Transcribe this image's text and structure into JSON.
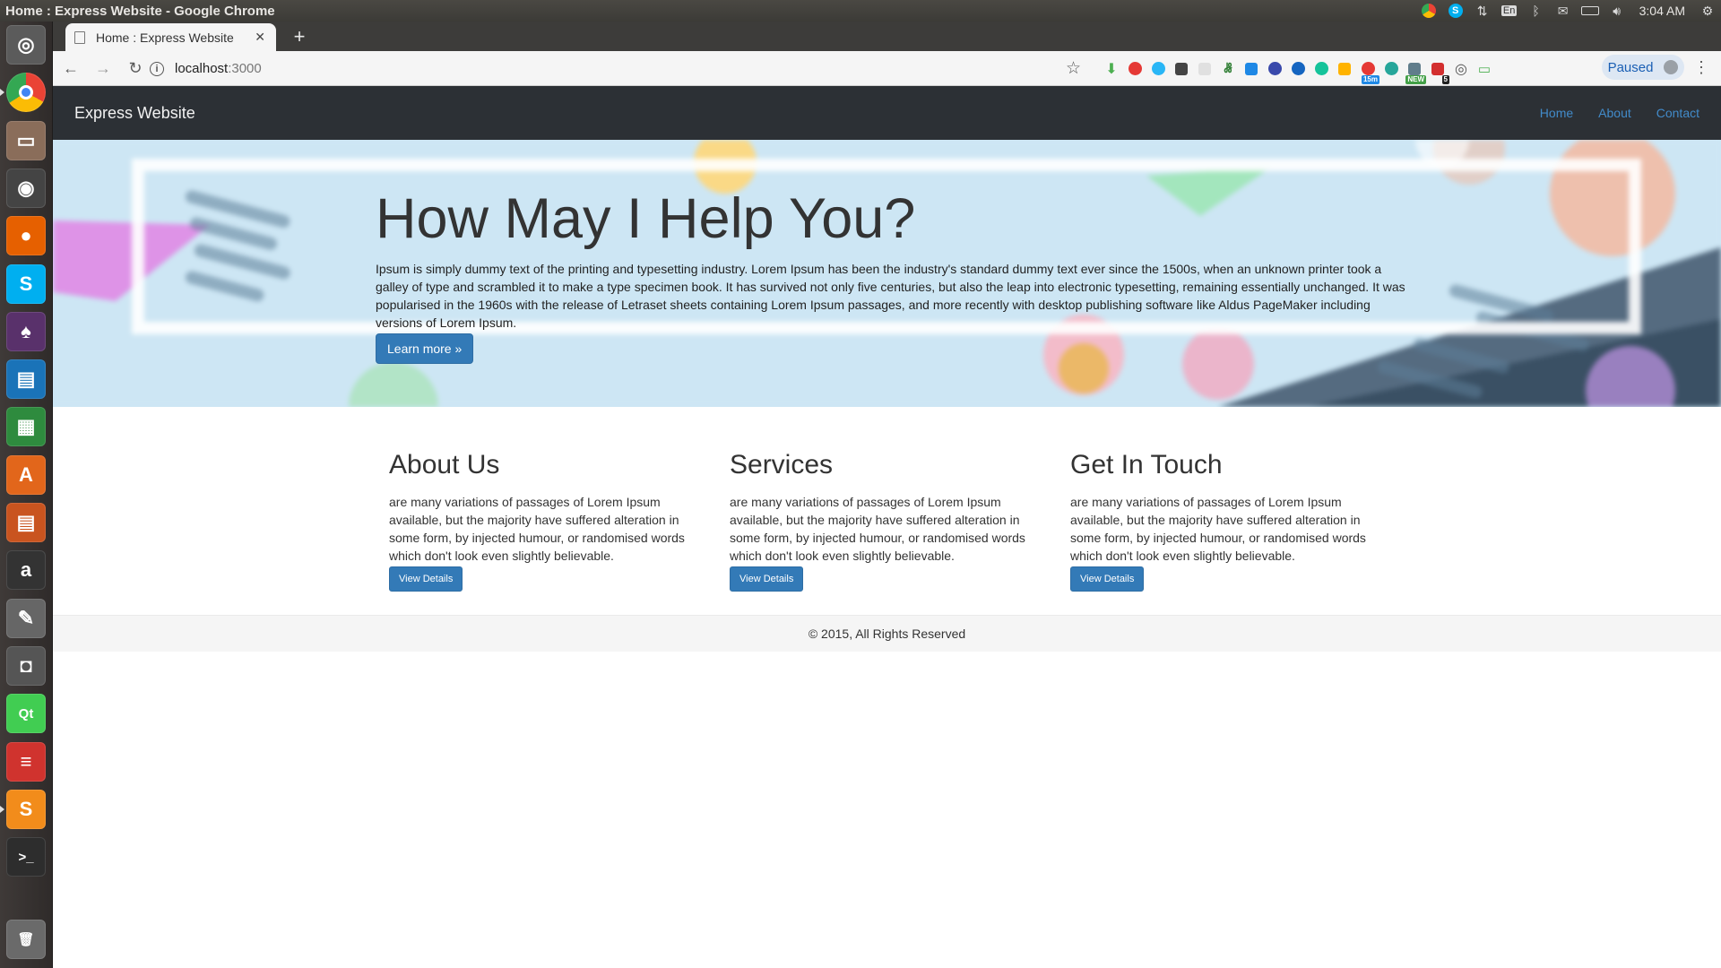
{
  "os": {
    "window_title": "Home : Express Website - Google Chrome",
    "keyboard_layout": "En",
    "clock": "3:04 AM"
  },
  "launcher": {
    "items": [
      {
        "name": "ubuntu-dash-icon",
        "glyph": "◎",
        "color": "#5b5b5b"
      },
      {
        "name": "chrome-icon",
        "glyph": "",
        "color": "#4285f4"
      },
      {
        "name": "file-manager-icon",
        "glyph": "▭",
        "color": "#8a6d5a"
      },
      {
        "name": "system-monitor-icon",
        "glyph": "◉",
        "color": "#444444"
      },
      {
        "name": "firefox-icon",
        "glyph": "●",
        "color": "#e66000"
      },
      {
        "name": "skype-icon",
        "glyph": "S",
        "color": "#00aff0"
      },
      {
        "name": "tor-browser-icon",
        "glyph": "♠",
        "color": "#59316b"
      },
      {
        "name": "libreoffice-writer-icon",
        "glyph": "▤",
        "color": "#1a73b8"
      },
      {
        "name": "libreoffice-calc-icon",
        "glyph": "▦",
        "color": "#2e8b3e"
      },
      {
        "name": "software-center-icon",
        "glyph": "A",
        "color": "#e2661b"
      },
      {
        "name": "libreoffice-impress-icon",
        "glyph": "▤",
        "color": "#c9541f"
      },
      {
        "name": "amazon-icon",
        "glyph": "a",
        "color": "#333333"
      },
      {
        "name": "settings-tools-icon",
        "glyph": "✎",
        "color": "#666666"
      },
      {
        "name": "camera-icon",
        "glyph": "◘",
        "color": "#555555"
      },
      {
        "name": "qt-creator-icon",
        "glyph": "Qt",
        "color": "#41cd52"
      },
      {
        "name": "red-app-icon",
        "glyph": "≡",
        "color": "#d0332e"
      },
      {
        "name": "sublime-text-icon",
        "glyph": "S",
        "color": "#f28c1b"
      },
      {
        "name": "terminal-icon",
        "glyph": ">_",
        "color": "#2d2d2d"
      },
      {
        "name": "trash-icon",
        "glyph": "🗑",
        "color": "#6a6a6a"
      }
    ]
  },
  "browser": {
    "tab_title": "Home : Express Website",
    "url_host": "localhost",
    "url_port": ":3000",
    "profile_label": "Paused",
    "extension_badges": {
      "time": "15m",
      "new": "NEW",
      "count": "5"
    }
  },
  "site": {
    "brand": "Express Website",
    "nav": [
      "Home",
      "About",
      "Contact"
    ],
    "hero": {
      "heading": "How May I Help You?",
      "body": "Ipsum is simply dummy text of the printing and typesetting industry. Lorem Ipsum has been the industry's standard dummy text ever since the 1500s, when an unknown printer took a galley of type and scrambled it to make a type specimen book. It has survived not only five centuries, but also the leap into electronic typesetting, remaining essentially unchanged. It was popularised in the 1960s with the release of Letraset sheets containing Lorem Ipsum passages, and more recently with desktop publishing software like Aldus PageMaker including versions of Lorem Ipsum.",
      "button": "Learn more »"
    },
    "features": [
      {
        "title": "About Us",
        "body": "are many variations of passages of Lorem Ipsum available, but the majority have suffered alteration in some form, by injected humour, or randomised words which don't look even slightly believable.",
        "button": "View Details"
      },
      {
        "title": "Services",
        "body": "are many variations of passages of Lorem Ipsum available, but the majority have suffered alteration in some form, by injected humour, or randomised words which don't look even slightly believable.",
        "button": "View Details"
      },
      {
        "title": "Get In Touch",
        "body": "are many variations of passages of Lorem Ipsum available, but the majority have suffered alteration in some form, by injected humour, or randomised words which don't look even slightly believable.",
        "button": "View Details"
      }
    ],
    "footer": "© 2015, All Rights Reserved"
  },
  "colors": {
    "navbar_bg": "#2c3035",
    "link": "#428bca",
    "primary_button": "#337ab7",
    "hero_bg": "#cde7f5"
  }
}
